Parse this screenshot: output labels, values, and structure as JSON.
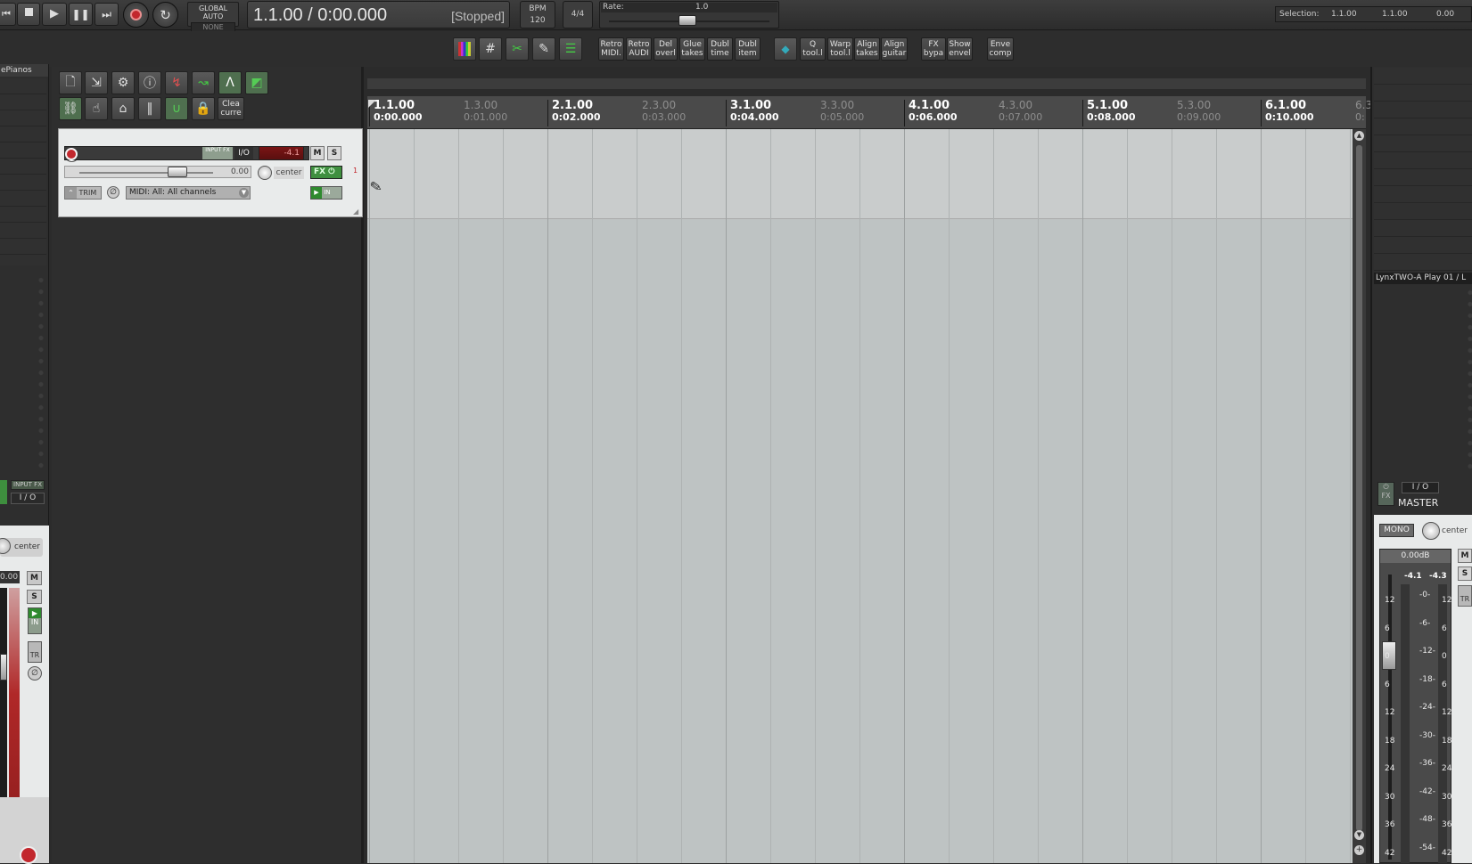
{
  "transport": {
    "time": "1.1.00 / 0:00.000",
    "status": "[Stopped]",
    "global_auto_label": "GLOBAL AUTO",
    "global_auto_value": "NONE",
    "bpm_label": "BPM",
    "bpm_value": "120",
    "time_sig": "4/4",
    "rate_label": "Rate:",
    "rate_value": "1.0"
  },
  "selection": {
    "label": "Selection:",
    "start": "1.1.00",
    "end": "1.1.00",
    "length": "0.00"
  },
  "toolbar": {
    "buttons": [
      {
        "l1": "Retro",
        "l2": "MIDI."
      },
      {
        "l1": "Retro",
        "l2": "AUDI"
      },
      {
        "l1": "Del",
        "l2": "overl"
      },
      {
        "l1": "Glue",
        "l2": "takes"
      },
      {
        "l1": "Dubl",
        "l2": "time"
      },
      {
        "l1": "Dubl",
        "l2": "item"
      },
      {
        "l1": "Q",
        "l2": "tool.l"
      },
      {
        "l1": "Warp",
        "l2": "tool.l"
      },
      {
        "l1": "Align",
        "l2": "takes"
      },
      {
        "l1": "Align",
        "l2": "guitar"
      },
      {
        "l1": "FX",
        "l2": "bypa"
      },
      {
        "l1": "Show",
        "l2": "envel"
      },
      {
        "l1": "Enve",
        "l2": "comp"
      }
    ],
    "clear_label_1": "Clea",
    "clear_label_2": "curre"
  },
  "left_panel": {
    "header": "ePianos",
    "input_fx": "INPUT FX",
    "io": "I / O",
    "pan": "center",
    "vol": "0.00",
    "m": "M",
    "s": "S",
    "in": "IN",
    "tr": "TR"
  },
  "track": {
    "input_fx": "INPUT FX",
    "io": "I/O",
    "vol_readout": "-4.1",
    "mute": "M",
    "solo": "S",
    "volume": "0.00",
    "pan": "center",
    "fx": "FX",
    "trim": "TRIM",
    "midi_input": "MIDI: All: All channels",
    "in_label": "IN",
    "number": "1"
  },
  "ruler": {
    "marks": [
      {
        "bar": "1.1.00",
        "time": "0:00.000",
        "major": true
      },
      {
        "bar": "1.3.00",
        "time": "0:01.000",
        "major": false
      },
      {
        "bar": "2.1.00",
        "time": "0:02.000",
        "major": true
      },
      {
        "bar": "2.3.00",
        "time": "0:03.000",
        "major": false
      },
      {
        "bar": "3.1.00",
        "time": "0:04.000",
        "major": true
      },
      {
        "bar": "3.3.00",
        "time": "0:05.000",
        "major": false
      },
      {
        "bar": "4.1.00",
        "time": "0:06.000",
        "major": true
      },
      {
        "bar": "4.3.00",
        "time": "0:07.000",
        "major": false
      },
      {
        "bar": "5.1.00",
        "time": "0:08.000",
        "major": true
      },
      {
        "bar": "5.3.00",
        "time": "0:09.000",
        "major": false
      },
      {
        "bar": "6.1.00",
        "time": "0:10.000",
        "major": true
      },
      {
        "bar": "6.3",
        "time": "0:",
        "major": false
      }
    ]
  },
  "master": {
    "device": "LynxTWO-A Play 01 / L",
    "io": "I / O",
    "fx": "FX",
    "name": "MASTER",
    "mono": "MONO",
    "pan": "center",
    "db": "0.00dB",
    "peak_l": "-4.1",
    "peak_r": "-4.3",
    "m": "M",
    "s": "S",
    "tr": "TR",
    "scale_left": [
      "12",
      "6",
      "0",
      "6",
      "12",
      "18",
      "24",
      "30",
      "36",
      "42"
    ],
    "scale_mid": [
      "-0-",
      "-6-",
      "-12-",
      "-18-",
      "-24-",
      "-30-",
      "-36-",
      "-42-",
      "-48-",
      "-54-"
    ],
    "scale_right": [
      "12",
      "6",
      "0",
      "6",
      "12",
      "18",
      "24",
      "30",
      "36",
      "42"
    ]
  },
  "colors": {
    "arrange_bg": "#bec3c3",
    "track_lane": "#c9cccc",
    "record_red": "#c2272d",
    "fx_green": "#4aa84a"
  }
}
